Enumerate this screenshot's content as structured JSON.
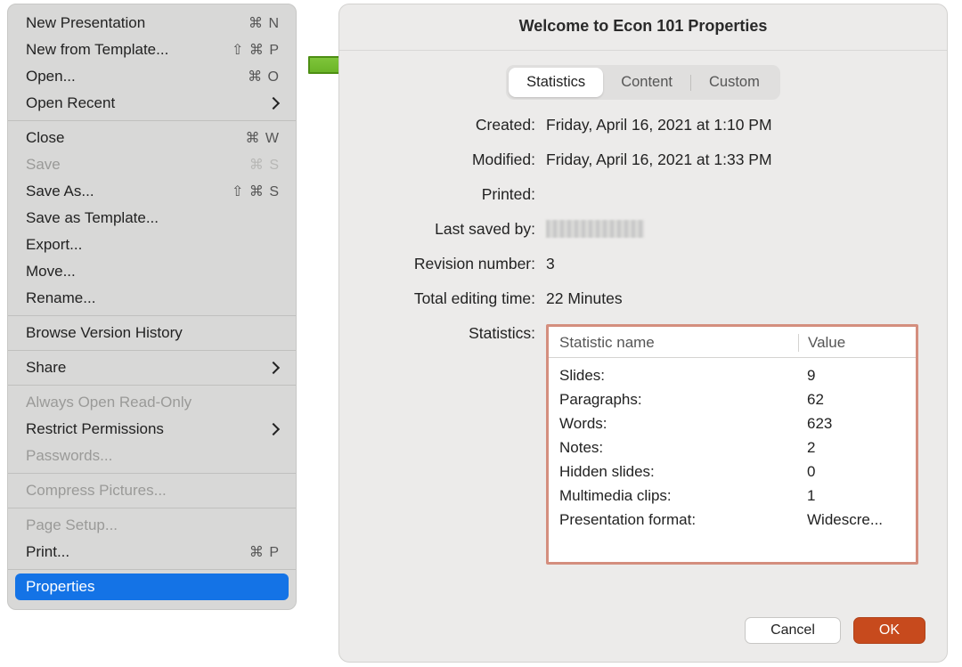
{
  "menu": {
    "new": {
      "label": "New Presentation",
      "short": "⌘ N"
    },
    "newTemplate": {
      "label": "New from Template...",
      "short": "⇧ ⌘ P"
    },
    "open": {
      "label": "Open...",
      "short": "⌘ O"
    },
    "openRecent": {
      "label": "Open Recent"
    },
    "close": {
      "label": "Close",
      "short": "⌘ W"
    },
    "save": {
      "label": "Save",
      "short": "⌘ S"
    },
    "saveAs": {
      "label": "Save As...",
      "short": "⇧ ⌘ S"
    },
    "saveTemplate": {
      "label": "Save as Template..."
    },
    "export": {
      "label": "Export..."
    },
    "move": {
      "label": "Move..."
    },
    "rename": {
      "label": "Rename..."
    },
    "history": {
      "label": "Browse Version History"
    },
    "share": {
      "label": "Share"
    },
    "readOnly": {
      "label": "Always Open Read-Only"
    },
    "restrict": {
      "label": "Restrict Permissions"
    },
    "passwords": {
      "label": "Passwords..."
    },
    "compress": {
      "label": "Compress Pictures..."
    },
    "pageSetup": {
      "label": "Page Setup..."
    },
    "print": {
      "label": "Print...",
      "short": "⌘ P"
    },
    "properties": {
      "label": "Properties"
    }
  },
  "dialog": {
    "title": "Welcome to Econ 101 Properties",
    "tabs": {
      "stats": "Statistics",
      "content": "Content",
      "custom": "Custom"
    },
    "fields": {
      "createdK": "Created:",
      "createdV": "Friday, April 16, 2021 at 1:10 PM",
      "modifiedK": "Modified:",
      "modifiedV": "Friday, April 16, 2021 at 1:33 PM",
      "printedK": "Printed:",
      "printedV": "",
      "savedK": "Last saved by:",
      "revK": "Revision number:",
      "revV": "3",
      "editK": "Total editing time:",
      "editV": "22 Minutes",
      "statsK": "Statistics:"
    },
    "statsHeader": {
      "name": "Statistic name",
      "value": "Value"
    },
    "stats": {
      "slidesK": "Slides:",
      "slidesV": "9",
      "paraK": "Paragraphs:",
      "paraV": "62",
      "wordsK": "Words:",
      "wordsV": "623",
      "notesK": "Notes:",
      "notesV": "2",
      "hiddenK": "Hidden slides:",
      "hiddenV": "0",
      "mediaK": "Multimedia clips:",
      "mediaV": "1",
      "fmtK": "Presentation format:",
      "fmtV": "Widescre..."
    },
    "buttons": {
      "cancel": "Cancel",
      "ok": "OK"
    }
  }
}
